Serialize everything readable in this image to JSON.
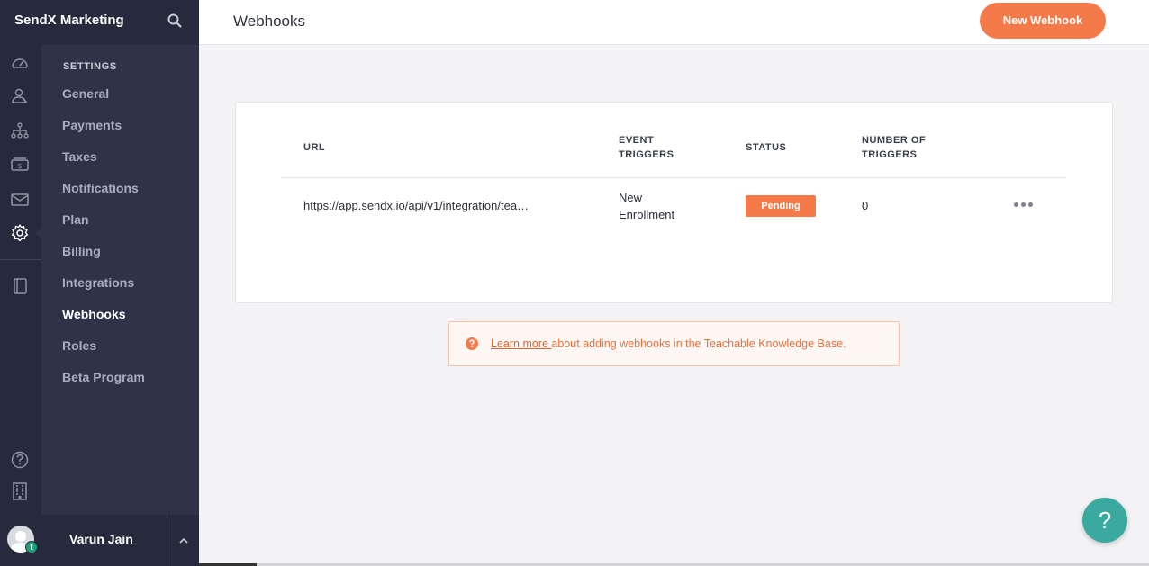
{
  "app": {
    "brand": "SendX Marketing"
  },
  "rail": {
    "icons": [
      "dashboard-icon",
      "users-icon",
      "sitemap-icon",
      "sales-icon",
      "mail-icon",
      "gear-icon",
      "book-icon",
      "help-circle-icon",
      "building-icon"
    ],
    "active": "gear-icon"
  },
  "settings_nav": {
    "heading": "SETTINGS",
    "items": [
      {
        "label": "General"
      },
      {
        "label": "Payments"
      },
      {
        "label": "Taxes"
      },
      {
        "label": "Notifications"
      },
      {
        "label": "Plan"
      },
      {
        "label": "Billing"
      },
      {
        "label": "Integrations"
      },
      {
        "label": "Webhooks"
      },
      {
        "label": "Roles"
      },
      {
        "label": "Beta Program"
      }
    ],
    "active": "Webhooks"
  },
  "user": {
    "name": "Varun Jain",
    "badge": "t"
  },
  "header": {
    "title": "Webhooks",
    "new_button": "New Webhook"
  },
  "table": {
    "headers": {
      "url": "URL",
      "event_triggers_1": "EVENT",
      "event_triggers_2": "TRIGGERS",
      "status": "STATUS",
      "number_1": "NUMBER OF",
      "number_2": "TRIGGERS"
    },
    "rows": [
      {
        "url": "https://app.sendx.io/api/v1/integration/tea…",
        "event_1": "New",
        "event_2": "Enrollment",
        "status": "Pending",
        "count": "0"
      }
    ]
  },
  "note": {
    "link": "Learn more ",
    "text": "about adding webhooks in the Teachable Knowledge Base."
  },
  "help_fab": "?",
  "colors": {
    "accent": "#f47a4a",
    "sidebar": "#2f3347",
    "rail": "#262a3c",
    "help": "#3aaaa0"
  }
}
